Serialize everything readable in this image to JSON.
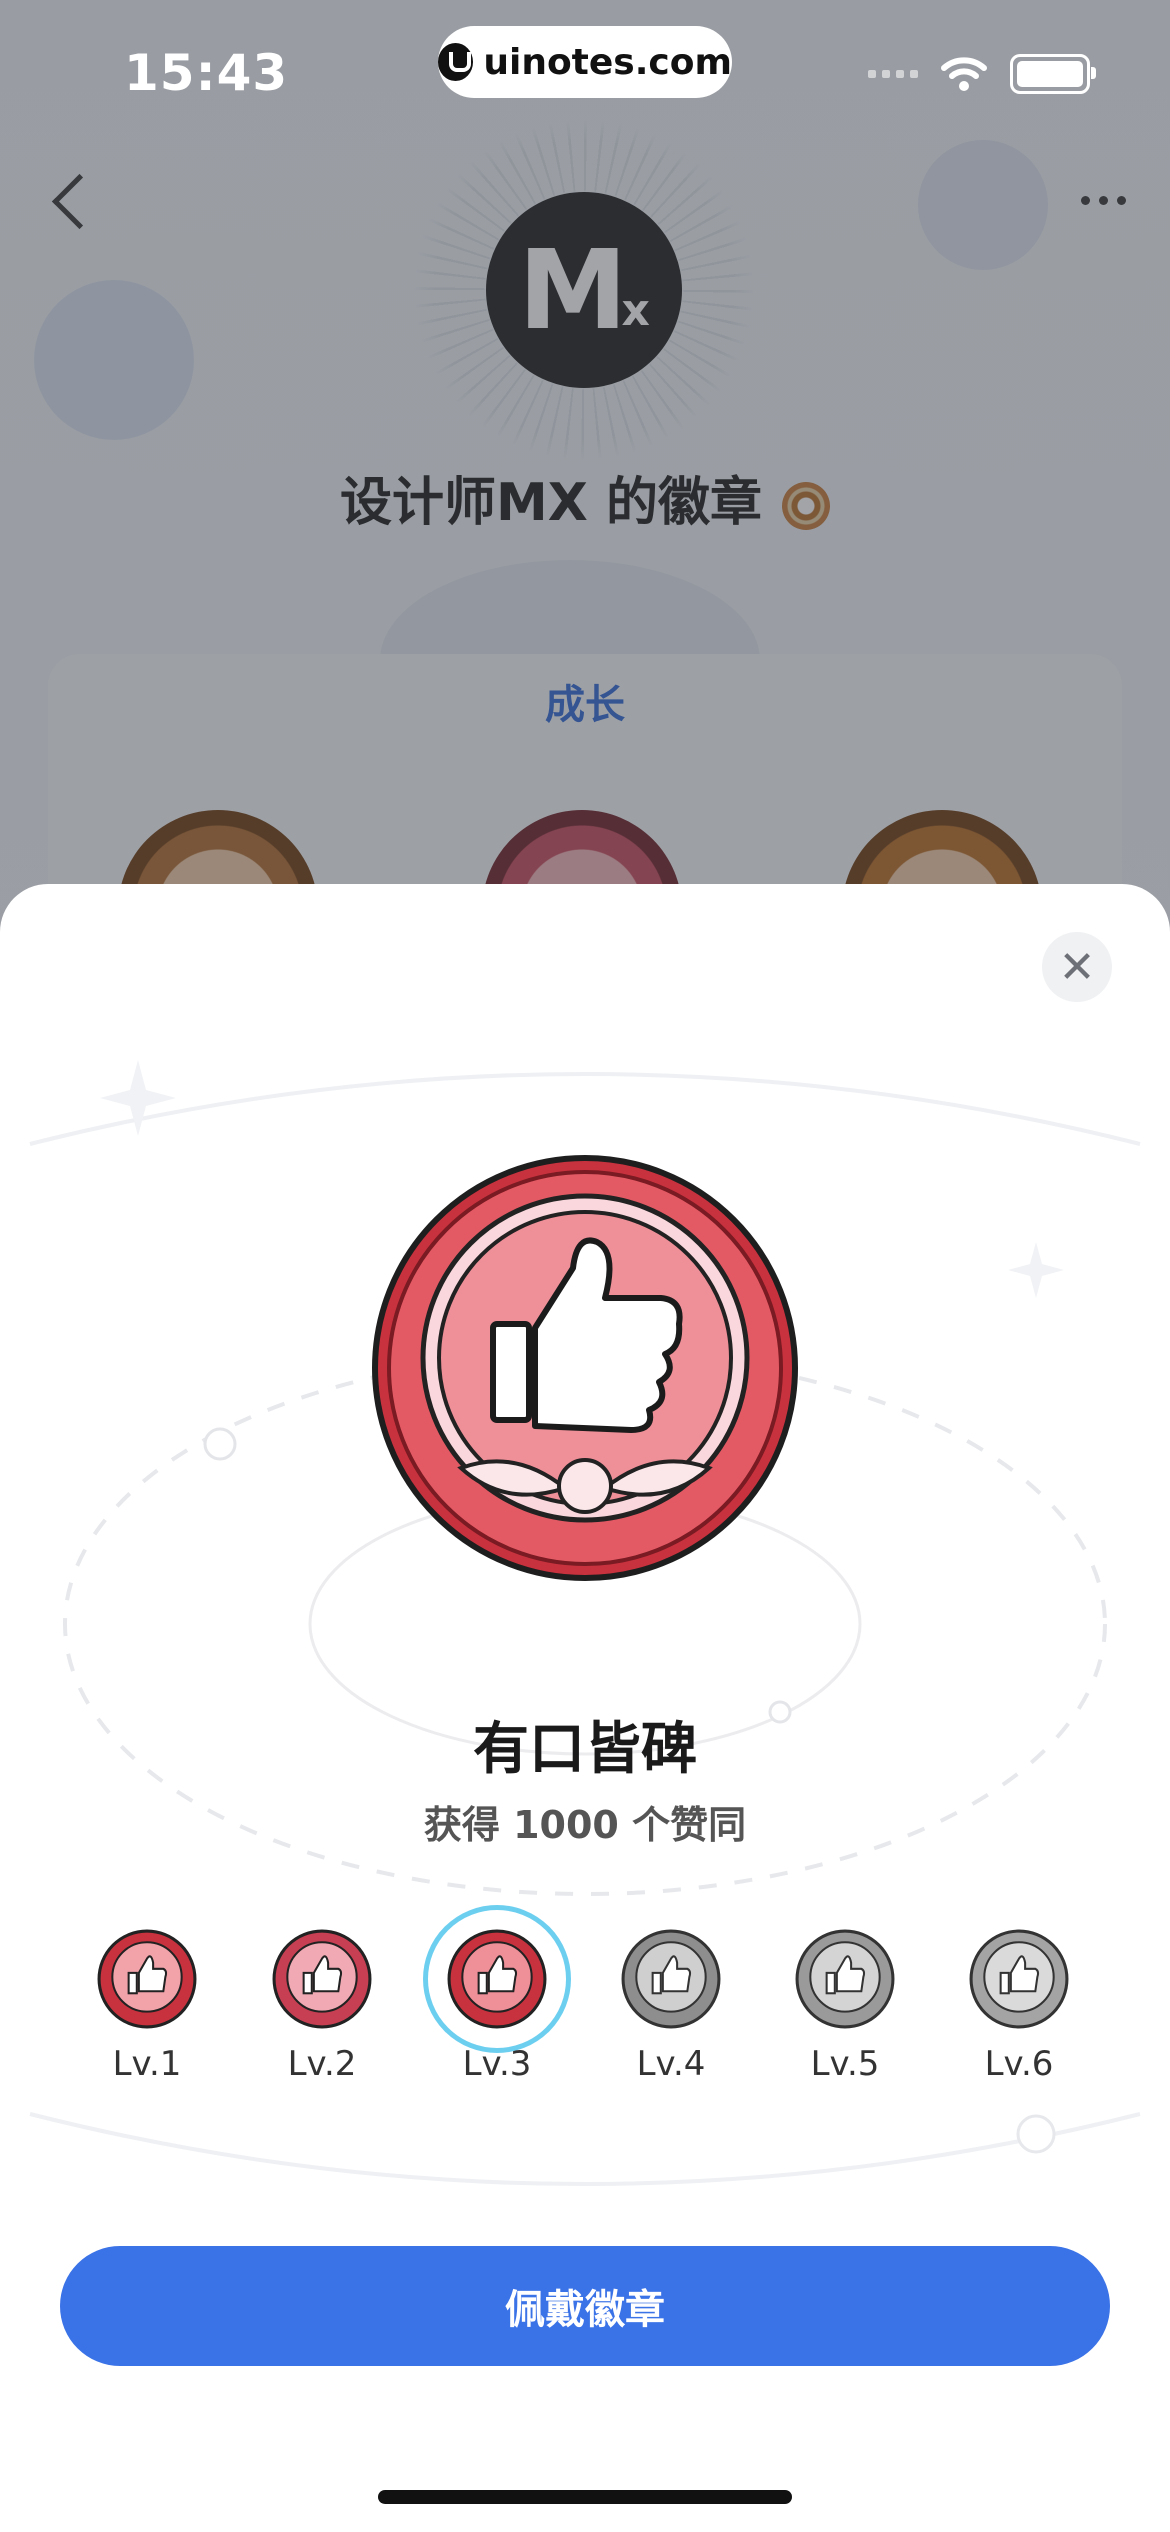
{
  "status": {
    "time": "15:43",
    "url": "uinotes.com"
  },
  "header": {
    "title": "设计师MX 的徽章",
    "avatar_text": "M",
    "avatar_sub": "x"
  },
  "category_tab": "成长",
  "sheet": {
    "badge_name": "有口皆碑",
    "badge_desc": "获得 1000 个赞同",
    "current_level": "Lv.3",
    "levels": [
      {
        "label": "Lv.1",
        "state": "unlocked"
      },
      {
        "label": "Lv.2",
        "state": "unlocked"
      },
      {
        "label": "Lv.3",
        "state": "current"
      },
      {
        "label": "Lv.4",
        "state": "locked"
      },
      {
        "label": "Lv.5",
        "state": "locked"
      },
      {
        "label": "Lv.6",
        "state": "locked"
      }
    ],
    "wear_button": "佩戴徽章",
    "close_icon": "close-icon"
  },
  "colors": {
    "accent": "#3a72e7",
    "badge_red": "#d9505c",
    "badge_gray": "#8c8c8c",
    "ring": "#6dcff0"
  }
}
